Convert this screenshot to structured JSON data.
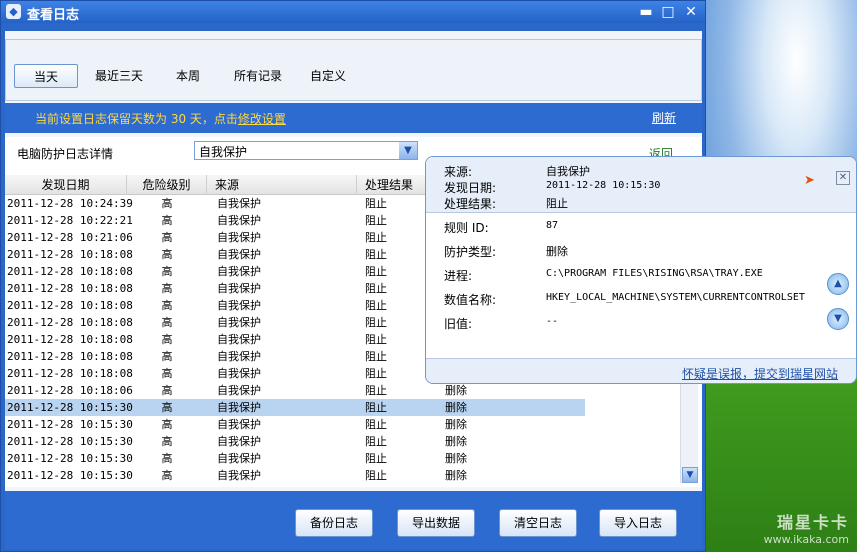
{
  "window": {
    "title": "查看日志"
  },
  "tabs": [
    "当天",
    "最近三天",
    "本周",
    "所有记录",
    "自定义"
  ],
  "notice": {
    "text": "当前设置日志保留天数为 30 天，点击",
    "link": "修改设置",
    "refresh": "刷新"
  },
  "filter": {
    "label": "电脑防护日志详情",
    "selected": "自我保护",
    "back": "返回"
  },
  "columns": [
    "发现日期",
    "危险级别",
    "来源",
    "处理结果"
  ],
  "rows": [
    {
      "date": "2011-12-28 10:24:39",
      "level": "高",
      "source": "自我保护",
      "result": "阻止",
      "op": ""
    },
    {
      "date": "2011-12-28 10:22:21",
      "level": "高",
      "source": "自我保护",
      "result": "阻止",
      "op": ""
    },
    {
      "date": "2011-12-28 10:21:06",
      "level": "高",
      "source": "自我保护",
      "result": "阻止",
      "op": ""
    },
    {
      "date": "2011-12-28 10:18:08",
      "level": "高",
      "source": "自我保护",
      "result": "阻止",
      "op": ""
    },
    {
      "date": "2011-12-28 10:18:08",
      "level": "高",
      "source": "自我保护",
      "result": "阻止",
      "op": ""
    },
    {
      "date": "2011-12-28 10:18:08",
      "level": "高",
      "source": "自我保护",
      "result": "阻止",
      "op": ""
    },
    {
      "date": "2011-12-28 10:18:08",
      "level": "高",
      "source": "自我保护",
      "result": "阻止",
      "op": ""
    },
    {
      "date": "2011-12-28 10:18:08",
      "level": "高",
      "source": "自我保护",
      "result": "阻止",
      "op": ""
    },
    {
      "date": "2011-12-28 10:18:08",
      "level": "高",
      "source": "自我保护",
      "result": "阻止",
      "op": ""
    },
    {
      "date": "2011-12-28 10:18:08",
      "level": "高",
      "source": "自我保护",
      "result": "阻止",
      "op": ""
    },
    {
      "date": "2011-12-28 10:18:08",
      "level": "高",
      "source": "自我保护",
      "result": "阻止",
      "op": ""
    },
    {
      "date": "2011-12-28 10:18:06",
      "level": "高",
      "source": "自我保护",
      "result": "阻止",
      "op": "删除"
    },
    {
      "date": "2011-12-28 10:15:30",
      "level": "高",
      "source": "自我保护",
      "result": "阻止",
      "op": "删除"
    },
    {
      "date": "2011-12-28 10:15:30",
      "level": "高",
      "source": "自我保护",
      "result": "阻止",
      "op": "删除"
    },
    {
      "date": "2011-12-28 10:15:30",
      "level": "高",
      "source": "自我保护",
      "result": "阻止",
      "op": "删除"
    },
    {
      "date": "2011-12-28 10:15:30",
      "level": "高",
      "source": "自我保护",
      "result": "阻止",
      "op": "删除"
    },
    {
      "date": "2011-12-28 10:15:30",
      "level": "高",
      "source": "自我保护",
      "result": "阻止",
      "op": "删除"
    }
  ],
  "selected_row_index": 12,
  "buttons": [
    "备份日志",
    "导出数据",
    "清空日志",
    "导入日志"
  ],
  "popup": {
    "source_label": "来源:",
    "source_value": "自我保护",
    "date_label": "发现日期:",
    "date_value": "2011-12-28 10:15:30",
    "result_label": "处理结果:",
    "result_value": "阻止",
    "rule_label": "规则 ID:",
    "rule_value": "87",
    "type_label": "防护类型:",
    "type_value": "删除",
    "process_label": "进程:",
    "process_value": "C:\\PROGRAM FILES\\RISING\\RSA\\TRAY.EXE",
    "valuename_label": "数值名称:",
    "valuename_value": "HKEY_LOCAL_MACHINE\\SYSTEM\\CURRENTCONTROLSET",
    "oldvalue_label": "旧值:",
    "oldvalue_value": "--",
    "report_link": "怀疑是误报，提交到瑞星网站"
  },
  "watermark": {
    "brand": "瑞星卡卡",
    "url": "www.ikaka.com"
  },
  "icons": {
    "app": "shield-icon",
    "pin": "pin-icon",
    "close": "close-icon",
    "minimize": "minimize-icon",
    "maximize": "maximize-icon",
    "up": "arrow-up-icon",
    "down": "arrow-down-icon"
  }
}
